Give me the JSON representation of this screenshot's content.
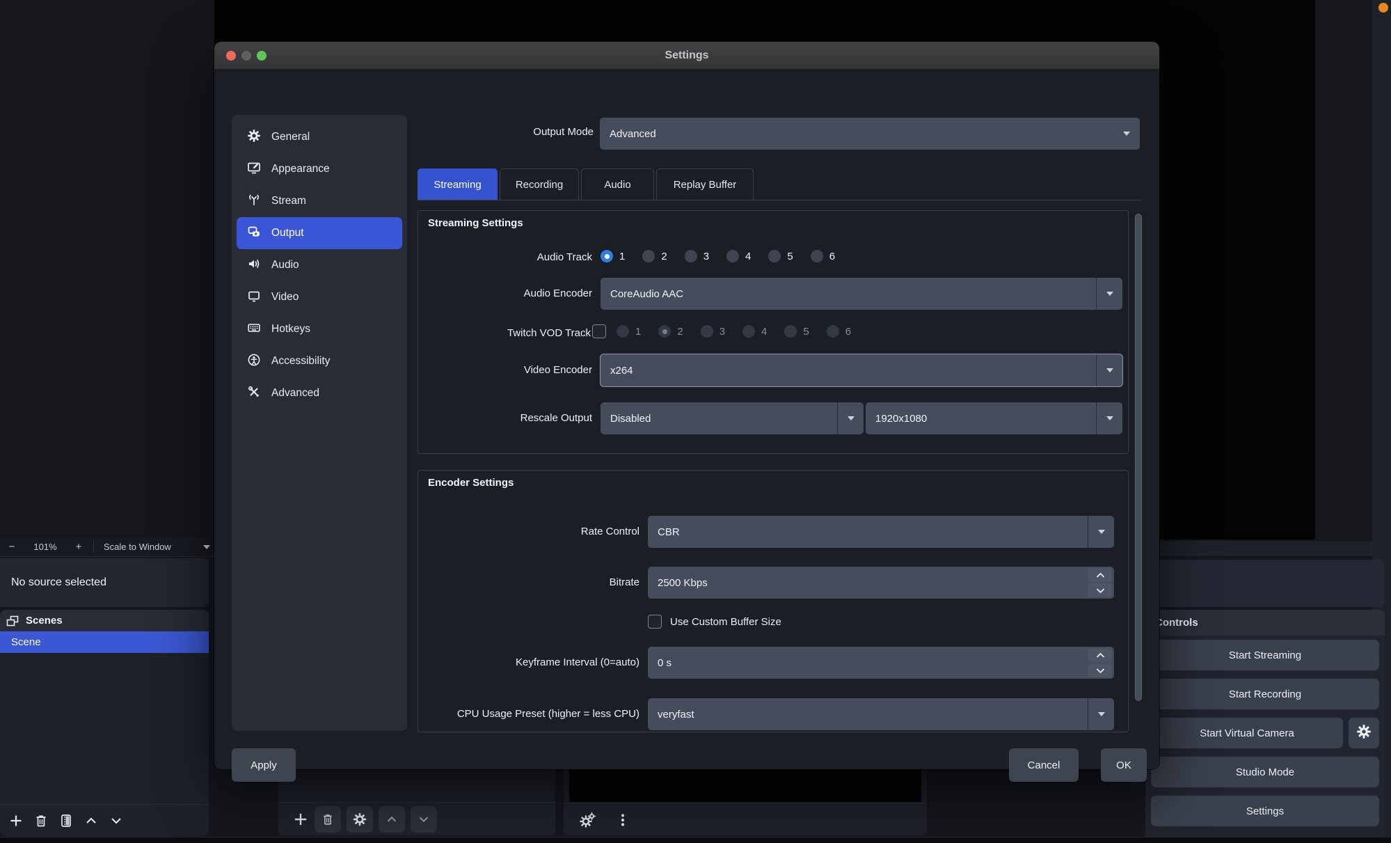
{
  "colors": {
    "accent_blue": "#3552cf",
    "radio_selected_blue": "#2f7de0",
    "scene_selected_blue": "#3b57d3",
    "traffic_red": "#ee6a5f",
    "traffic_gray": "#5d5f61",
    "traffic_green": "#61c554",
    "record_indicator_orange": "#e8871e"
  },
  "dialog": {
    "title": "Settings",
    "sidebar": [
      {
        "label": "General",
        "icon": "gear-icon"
      },
      {
        "label": "Appearance",
        "icon": "appearance-icon"
      },
      {
        "label": "Stream",
        "icon": "stream-icon"
      },
      {
        "label": "Output",
        "icon": "output-icon",
        "selected": true
      },
      {
        "label": "Audio",
        "icon": "audio-icon"
      },
      {
        "label": "Video",
        "icon": "video-icon"
      },
      {
        "label": "Hotkeys",
        "icon": "hotkeys-icon"
      },
      {
        "label": "Accessibility",
        "icon": "accessibility-icon"
      },
      {
        "label": "Advanced",
        "icon": "advanced-icon"
      }
    ],
    "output_mode": {
      "label": "Output Mode",
      "value": "Advanced"
    },
    "tabs": [
      {
        "label": "Streaming",
        "selected": true
      },
      {
        "label": "Recording",
        "selected": false
      },
      {
        "label": "Audio",
        "selected": false
      },
      {
        "label": "Replay Buffer",
        "selected": false
      }
    ],
    "streaming": {
      "title": "Streaming Settings",
      "audio_track": {
        "label": "Audio Track",
        "selected": "1",
        "options": [
          "1",
          "2",
          "3",
          "4",
          "5",
          "6"
        ]
      },
      "audio_encoder": {
        "label": "Audio Encoder",
        "value": "CoreAudio AAC"
      },
      "twitch_vod": {
        "label": "Twitch VOD Track",
        "checked": false,
        "enabled": false,
        "selected": "2",
        "options": [
          "1",
          "2",
          "3",
          "4",
          "5",
          "6"
        ]
      },
      "video_encoder": {
        "label": "Video Encoder",
        "value": "x264"
      },
      "rescale": {
        "label": "Rescale Output",
        "value": "Disabled",
        "resolution": "1920x1080"
      }
    },
    "encoder": {
      "title": "Encoder Settings",
      "rate_control": {
        "label": "Rate Control",
        "value": "CBR"
      },
      "bitrate": {
        "label": "Bitrate",
        "value": "2500 Kbps"
      },
      "custom_buffer": {
        "label": "Use Custom Buffer Size",
        "checked": false
      },
      "keyframe": {
        "label": "Keyframe Interval (0=auto)",
        "value": "0 s"
      },
      "cpu_preset": {
        "label": "CPU Usage Preset (higher = less CPU)",
        "value": "veryfast"
      }
    },
    "buttons": {
      "apply": "Apply",
      "cancel": "Cancel",
      "ok": "OK"
    }
  },
  "main": {
    "preview_toolbar": {
      "zoom_out": "−",
      "zoom_level": "101%",
      "zoom_in": "+",
      "scale_mode": "Scale to Window"
    },
    "no_source": "No source selected",
    "scenes": {
      "header": "Scenes",
      "selected_scene": "Scene"
    },
    "controls": {
      "header": "Controls",
      "start_streaming": "Start Streaming",
      "start_recording": "Start Recording",
      "start_virtual_camera": "Start Virtual Camera",
      "studio_mode": "Studio Mode",
      "settings": "Settings"
    }
  }
}
